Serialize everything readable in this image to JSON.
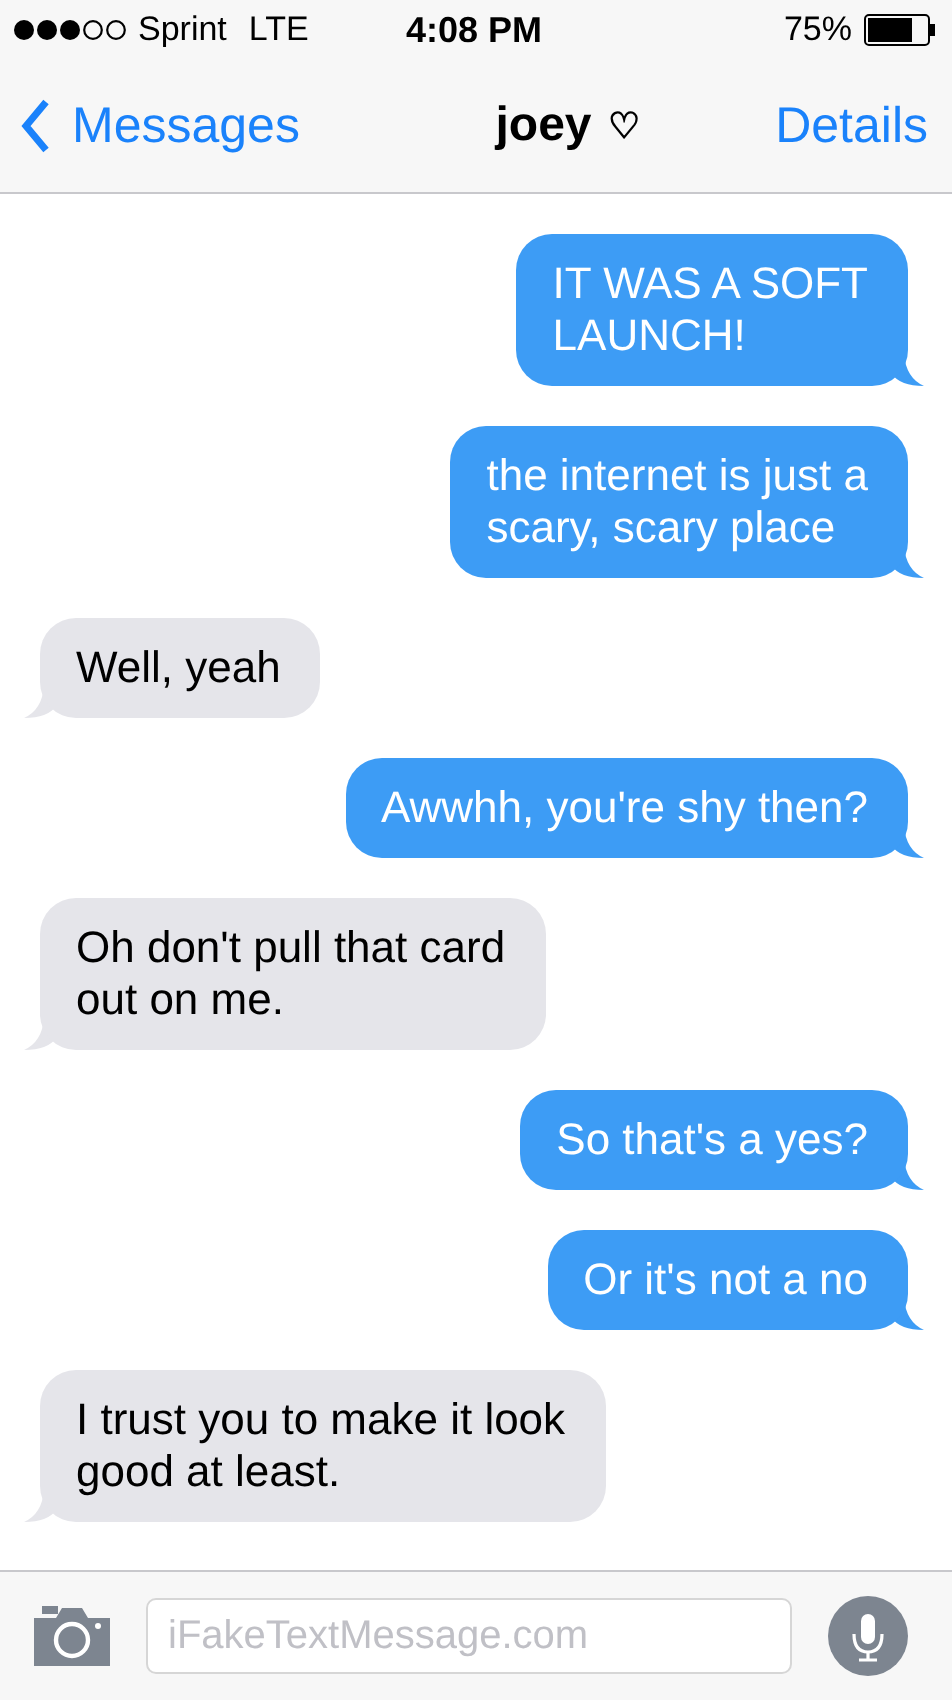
{
  "status_bar": {
    "carrier": "Sprint",
    "network": "LTE",
    "time": "4:08 PM",
    "battery": "75%"
  },
  "nav": {
    "back": "Messages",
    "title": "joey",
    "title_symbol": "♡",
    "action": "Details"
  },
  "messages": [
    {
      "kind": "sent",
      "lines": [
        "IT WAS A SOFT",
        "LAUNCH!"
      ]
    },
    {
      "kind": "sent",
      "lines": [
        "the internet is just a",
        "scary, scary place"
      ]
    },
    {
      "kind": "received",
      "lines": [
        "Well, yeah"
      ]
    },
    {
      "kind": "sent",
      "lines": [
        "Awwhh, you're shy then?"
      ]
    },
    {
      "kind": "received",
      "lines": [
        "Oh don't pull that card",
        "out on me."
      ]
    },
    {
      "kind": "sent",
      "lines": [
        "So that's a yes?"
      ]
    },
    {
      "kind": "sent",
      "lines": [
        "Or it's not a no"
      ]
    },
    {
      "kind": "received",
      "lines": [
        "I trust you to make it look",
        "good at least."
      ]
    }
  ],
  "composer": {
    "placeholder": "iFakeTextMessage.com"
  }
}
